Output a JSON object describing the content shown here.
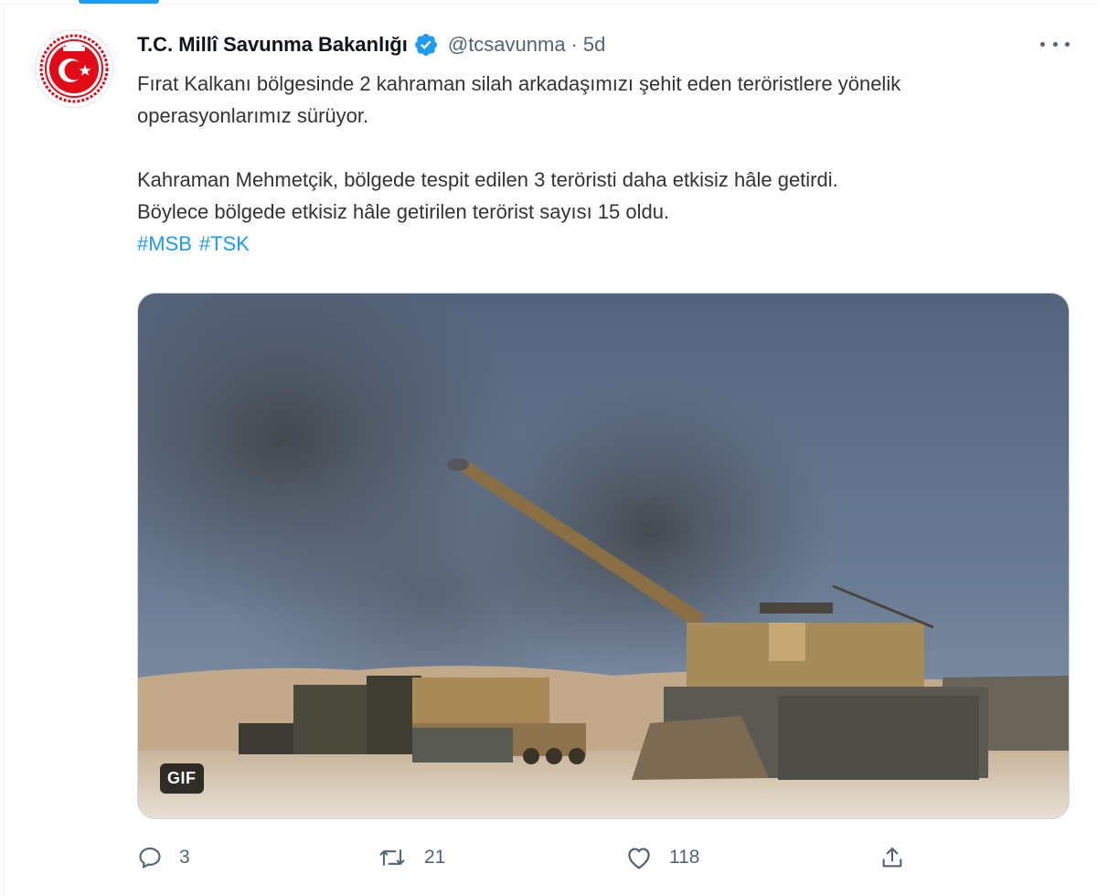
{
  "tweet": {
    "author": {
      "display_name": "T.C. Millî Savunma Bakanlığı",
      "handle": "@tcsavunma",
      "verified": true,
      "avatar_icon": "ministry-emblem-icon"
    },
    "separator": "·",
    "time": "5d",
    "text": {
      "paragraph1": "Fırat Kalkanı bölgesinde 2 kahraman silah arkadaşımızı şehit eden teröristlere yönelik operasyonlarımız sürüyor.",
      "paragraph2_line1": "Kahraman Mehmetçik, bölgede tespit edilen 3 teröristi daha etkisiz hâle getirdi.",
      "paragraph2_line2": "Böylece bölgede etkisiz hâle getirilen terörist sayısı 15 oldu.",
      "hashtags": [
        "#MSB",
        "#TSK"
      ]
    },
    "media": {
      "type": "gif",
      "badge": "GIF"
    },
    "actions": {
      "reply": {
        "icon": "reply-icon",
        "count": "3"
      },
      "retweet": {
        "icon": "retweet-icon",
        "count": "21"
      },
      "like": {
        "icon": "like-icon",
        "count": "118"
      },
      "share": {
        "icon": "share-icon"
      }
    }
  },
  "colors": {
    "accent": "#1d9bf0",
    "text_secondary": "#536471",
    "emblem_red": "#e30a17"
  }
}
